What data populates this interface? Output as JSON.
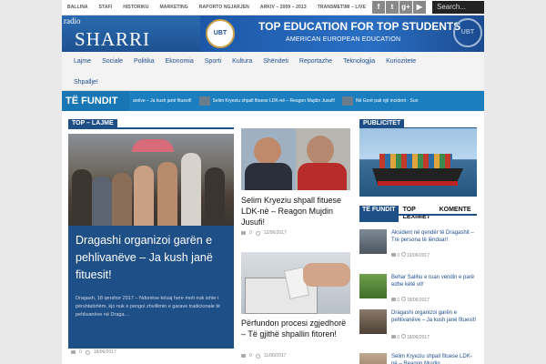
{
  "topnav": [
    "BALLINA",
    "STAFI",
    "HISTORIKU",
    "MARKETING",
    "RAPORTO NGJARJEN",
    "ARKIV – 2009 – 2013",
    "TRANSMETIMI – LIVE"
  ],
  "social": {
    "twitter": "t",
    "gplus": "g+",
    "youtube": "▶"
  },
  "search": {
    "placeholder": "Search..."
  },
  "logo": {
    "small": "radio",
    "big": "SHARRI"
  },
  "banner": {
    "logo_text": "UBT",
    "title": "TOP EDUCATION FOR TOP STUDENTS",
    "subtitle": "AMERICAN EUROPEAN EDUCATION",
    "logo2_text": "UBT"
  },
  "mainnav": {
    "items": [
      "Lajme",
      "Sociale",
      "Politika",
      "Ekonomia",
      "Sporti",
      "Kultura",
      "Shëndeti",
      "Reportazhe",
      "Teknologjia",
      "Kuriozitete"
    ],
    "second_row": "Shpallje!"
  },
  "ticker": {
    "label": "TË FUNDIT",
    "items": [
      "anëve – Ja kush janë fituesit!",
      "Selim Kryeziu shpall fituese LDK-në – Reagon Mujdin Jusufi!",
      "Në Gorë pati një incident - Sun"
    ]
  },
  "sections": {
    "top_lajme": "TOP – LAJME",
    "publicitet": "PUBLICITET"
  },
  "feature": {
    "title": "Dragashi organizoi garën e pehlivanëve – Ja kush janë fituesit!",
    "excerpt": "Dragash, 18 qershor 2017 – Ndonëse kësaj here moti nuk ishte i përshtatshëm, kjo nuk e pengoi zhvillimin e garave tradicionale të pehlivanëve në Draga…",
    "comments": "0",
    "date": "18/06/2017"
  },
  "articles": [
    {
      "title": "Selim Kryeziu shpall fituese LDK-në – Reagon Mujdin Jusufi!",
      "comments": "0",
      "date": "12/06/2017"
    },
    {
      "title": "Përfundon procesi zgjedhorë – Të gjithë shpallin fitoren!",
      "comments": "0",
      "date": "11/06/2017"
    }
  ],
  "sidebar": {
    "tabs": [
      "TË FUNDIT",
      "TOP LEXIMET",
      "KOMENTE"
    ],
    "items": [
      {
        "title": "Aksident në qendër të Dragashit – Tre persona të lënduar!",
        "comments": "0",
        "date": "19/06/2017"
      },
      {
        "title": "Behar Salihu e ruan vendin e parë edhe këtë vit!",
        "comments": "0",
        "date": "18/06/2017"
      },
      {
        "title": "Dragashi organizoi garën e pehlivanëve – Ja kush janë fituesit!",
        "comments": "0",
        "date": "18/06/2017"
      },
      {
        "title": "Selim Kryeziu shpall fituese LDK-në – Reagon Mujdin",
        "comments": "",
        "date": ""
      }
    ]
  },
  "colors": {
    "brand": "#1f4f87",
    "ticker": "#1b7fbf"
  }
}
